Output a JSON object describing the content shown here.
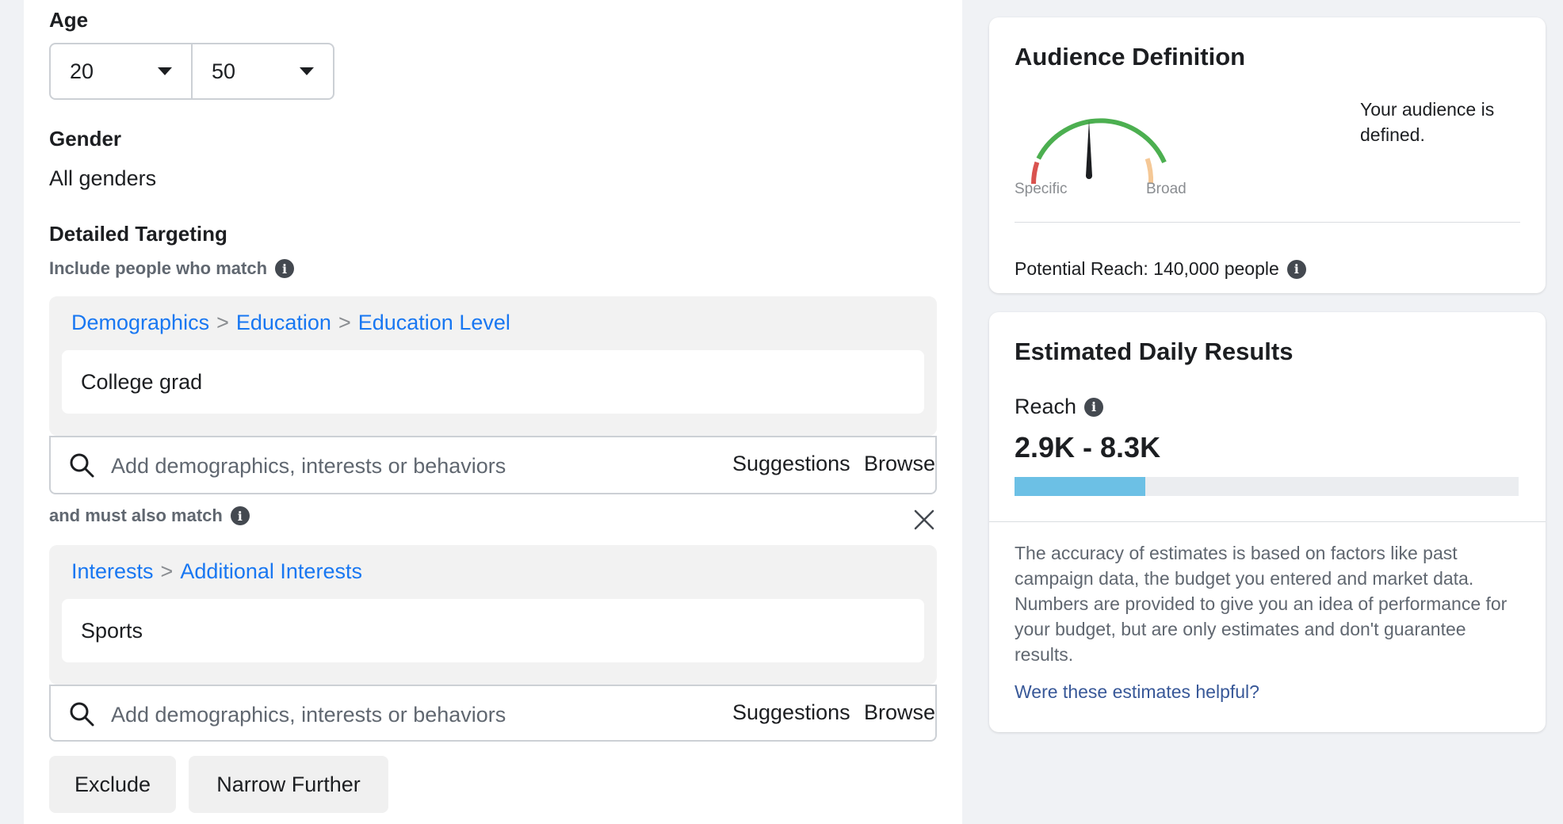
{
  "age": {
    "label": "Age",
    "min": "20",
    "max": "50"
  },
  "gender": {
    "label": "Gender",
    "value": "All genders"
  },
  "detailed_targeting": {
    "label": "Detailed Targeting",
    "include_label": "Include people who match",
    "also_match_label": "and must also match",
    "groups": [
      {
        "breadcrumb": [
          "Demographics",
          "Education",
          "Education Level"
        ],
        "separator": ">",
        "selected": "College grad"
      },
      {
        "breadcrumb": [
          "Interests",
          "Additional Interests"
        ],
        "separator": ">",
        "selected": "Sports"
      }
    ],
    "search_placeholder": "Add demographics, interests or behaviors",
    "suggestions_label": "Suggestions",
    "browse_label": "Browse",
    "exclude_label": "Exclude",
    "narrow_label": "Narrow Further"
  },
  "audience_definition": {
    "title": "Audience Definition",
    "specific_label": "Specific",
    "broad_label": "Broad",
    "status": "Your audience is defined.",
    "potential_reach": "Potential Reach: 140,000 people",
    "gauge_level": 0.5
  },
  "estimated_results": {
    "title": "Estimated Daily Results",
    "reach_label": "Reach",
    "reach_value": "2.9K - 8.3K",
    "reach_bar_fraction": 0.26,
    "disclaimer": "The accuracy of estimates is based on factors like past campaign data, the budget you entered and market data. Numbers are provided to give you an idea of performance for your budget, but are only estimates and don't guarantee results.",
    "helpful_link": "Were these estimates helpful?"
  },
  "icons": [
    "caret-down-icon",
    "info-icon",
    "search-icon",
    "close-icon",
    "gauge-needle-icon"
  ],
  "colors": {
    "link": "#1877f2",
    "gauge_green": "#4caf50",
    "gauge_red": "#d9534f",
    "gauge_orange": "#f5c896",
    "reach_bar": "#6cc0e5",
    "helpful_link": "#385898"
  }
}
